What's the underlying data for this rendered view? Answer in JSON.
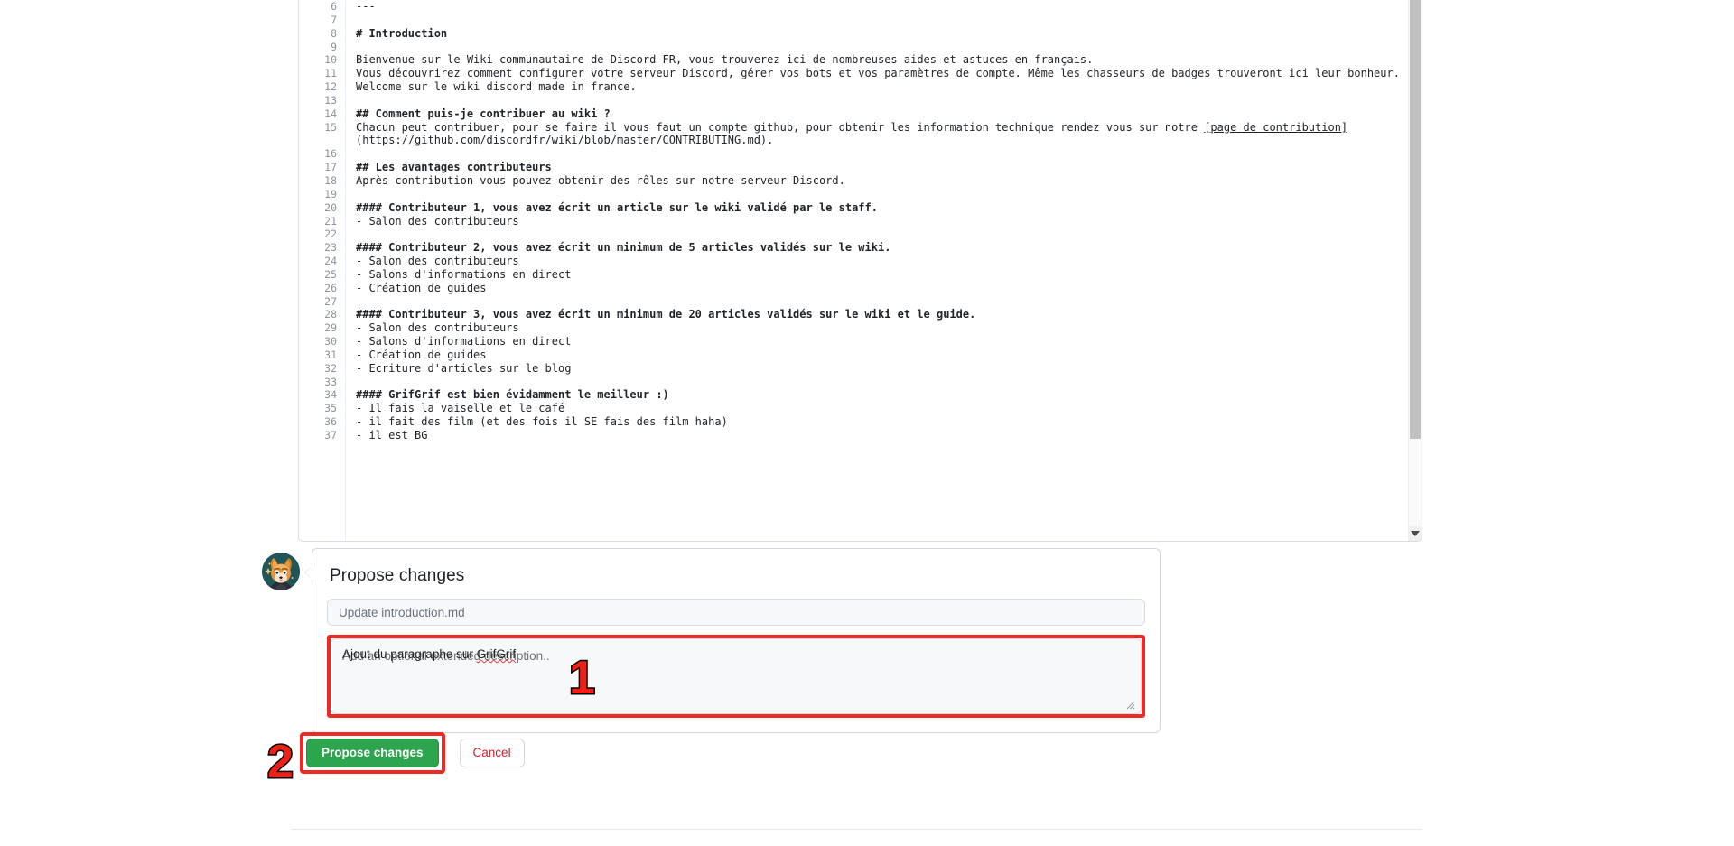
{
  "editor": {
    "name": "markdown-file-editor",
    "first_visible_line": 6,
    "lines": [
      {
        "n": 6,
        "text": "---",
        "bold": false
      },
      {
        "n": 7,
        "text": "",
        "bold": false
      },
      {
        "n": 8,
        "text": "# Introduction",
        "bold": true
      },
      {
        "n": 9,
        "text": "",
        "bold": false
      },
      {
        "n": 10,
        "text": "Bienvenue sur le Wiki communautaire de Discord FR, vous trouverez ici de nombreuses aides et astuces en français.",
        "bold": false
      },
      {
        "n": 11,
        "text": "Vous découvrirez comment configurer votre serveur Discord, gérer vos bots et vos paramètres de compte. Même les chasseurs de badges trouveront ici leur bonheur.",
        "bold": false
      },
      {
        "n": 12,
        "text": "Welcome sur le wiki discord made in france.",
        "bold": false
      },
      {
        "n": 13,
        "text": "",
        "bold": false
      },
      {
        "n": 14,
        "text": "## Comment puis-je contribuer au wiki ?",
        "bold": true
      },
      {
        "n": 15,
        "text": "Chacun peut contribuer, pour se faire il vous faut un compte github, pour obtenir les information technique rendez vous sur notre [page de contribution]",
        "bold": false,
        "wrap": "(https://github.com/discordfr/wiki/blob/master/CONTRIBUTING.md).",
        "link_start": "[page de contribution]"
      },
      {
        "n": 16,
        "text": "",
        "bold": false
      },
      {
        "n": 17,
        "text": "## Les avantages contributeurs",
        "bold": true
      },
      {
        "n": 18,
        "text": "Après contribution vous pouvez obtenir des rôles sur notre serveur Discord.",
        "bold": false
      },
      {
        "n": 19,
        "text": "",
        "bold": false
      },
      {
        "n": 20,
        "text": "#### Contributeur 1, vous avez écrit un article sur le wiki validé par le staff.",
        "bold": true
      },
      {
        "n": 21,
        "text": "- Salon des contributeurs",
        "bold": false
      },
      {
        "n": 22,
        "text": "",
        "bold": false
      },
      {
        "n": 23,
        "text": "#### Contributeur 2, vous avez écrit un minimum de 5 articles validés sur le wiki.",
        "bold": true
      },
      {
        "n": 24,
        "text": "- Salon des contributeurs",
        "bold": false
      },
      {
        "n": 25,
        "text": "- Salons d'informations en direct",
        "bold": false
      },
      {
        "n": 26,
        "text": "- Création de guides",
        "bold": false
      },
      {
        "n": 27,
        "text": "",
        "bold": false
      },
      {
        "n": 28,
        "text": "#### Contributeur 3, vous avez écrit un minimum de 20 articles validés sur le wiki et le guide.",
        "bold": true
      },
      {
        "n": 29,
        "text": "- Salon des contributeurs",
        "bold": false
      },
      {
        "n": 30,
        "text": "- Salons d'informations en direct",
        "bold": false
      },
      {
        "n": 31,
        "text": "- Création de guides",
        "bold": false
      },
      {
        "n": 32,
        "text": "- Ecriture d'articles sur le blog",
        "bold": false
      },
      {
        "n": 33,
        "text": "",
        "bold": false
      },
      {
        "n": 34,
        "text": "#### GrifGrif est bien évidamment le meilleur :)",
        "bold": true
      },
      {
        "n": 35,
        "text": "- Il fais la vaiselle et le café",
        "bold": false
      },
      {
        "n": 36,
        "text": "- il fait des film (et des fois il SE fais des film haha)",
        "bold": false
      },
      {
        "n": 37,
        "text": "- il est BG",
        "bold": false
      }
    ]
  },
  "commit_form": {
    "title": "Propose changes",
    "summary_placeholder": "Update introduction.md",
    "summary_value": "",
    "description_value": "Ajout du paragraphe sur GrifGrif",
    "description_spellchecked_word": "GrifGrif",
    "description_prefix": "Ajout du paragraphe sur ",
    "description_placeholder": "Add an optional extended description..",
    "submit_label": "Propose changes",
    "cancel_label": "Cancel"
  },
  "annotations": [
    {
      "id": "1",
      "label": "1",
      "target": "description-textarea"
    },
    {
      "id": "2",
      "label": "2",
      "target": "propose-changes-button"
    }
  ],
  "colors": {
    "annotation_red": "#f01f16",
    "highlight_border": "#ee2a24",
    "primary_button": "#2da44e",
    "cancel_text": "#cf222e",
    "avatar_background": "#20565a",
    "line_number": "#8c959f",
    "code_text": "#1f2328",
    "field_background": "#f6f8fa",
    "border": "#d0d7de"
  },
  "scrollbar": {
    "orientation": "vertical",
    "arrow_down_icon": "triangle-down-icon"
  }
}
